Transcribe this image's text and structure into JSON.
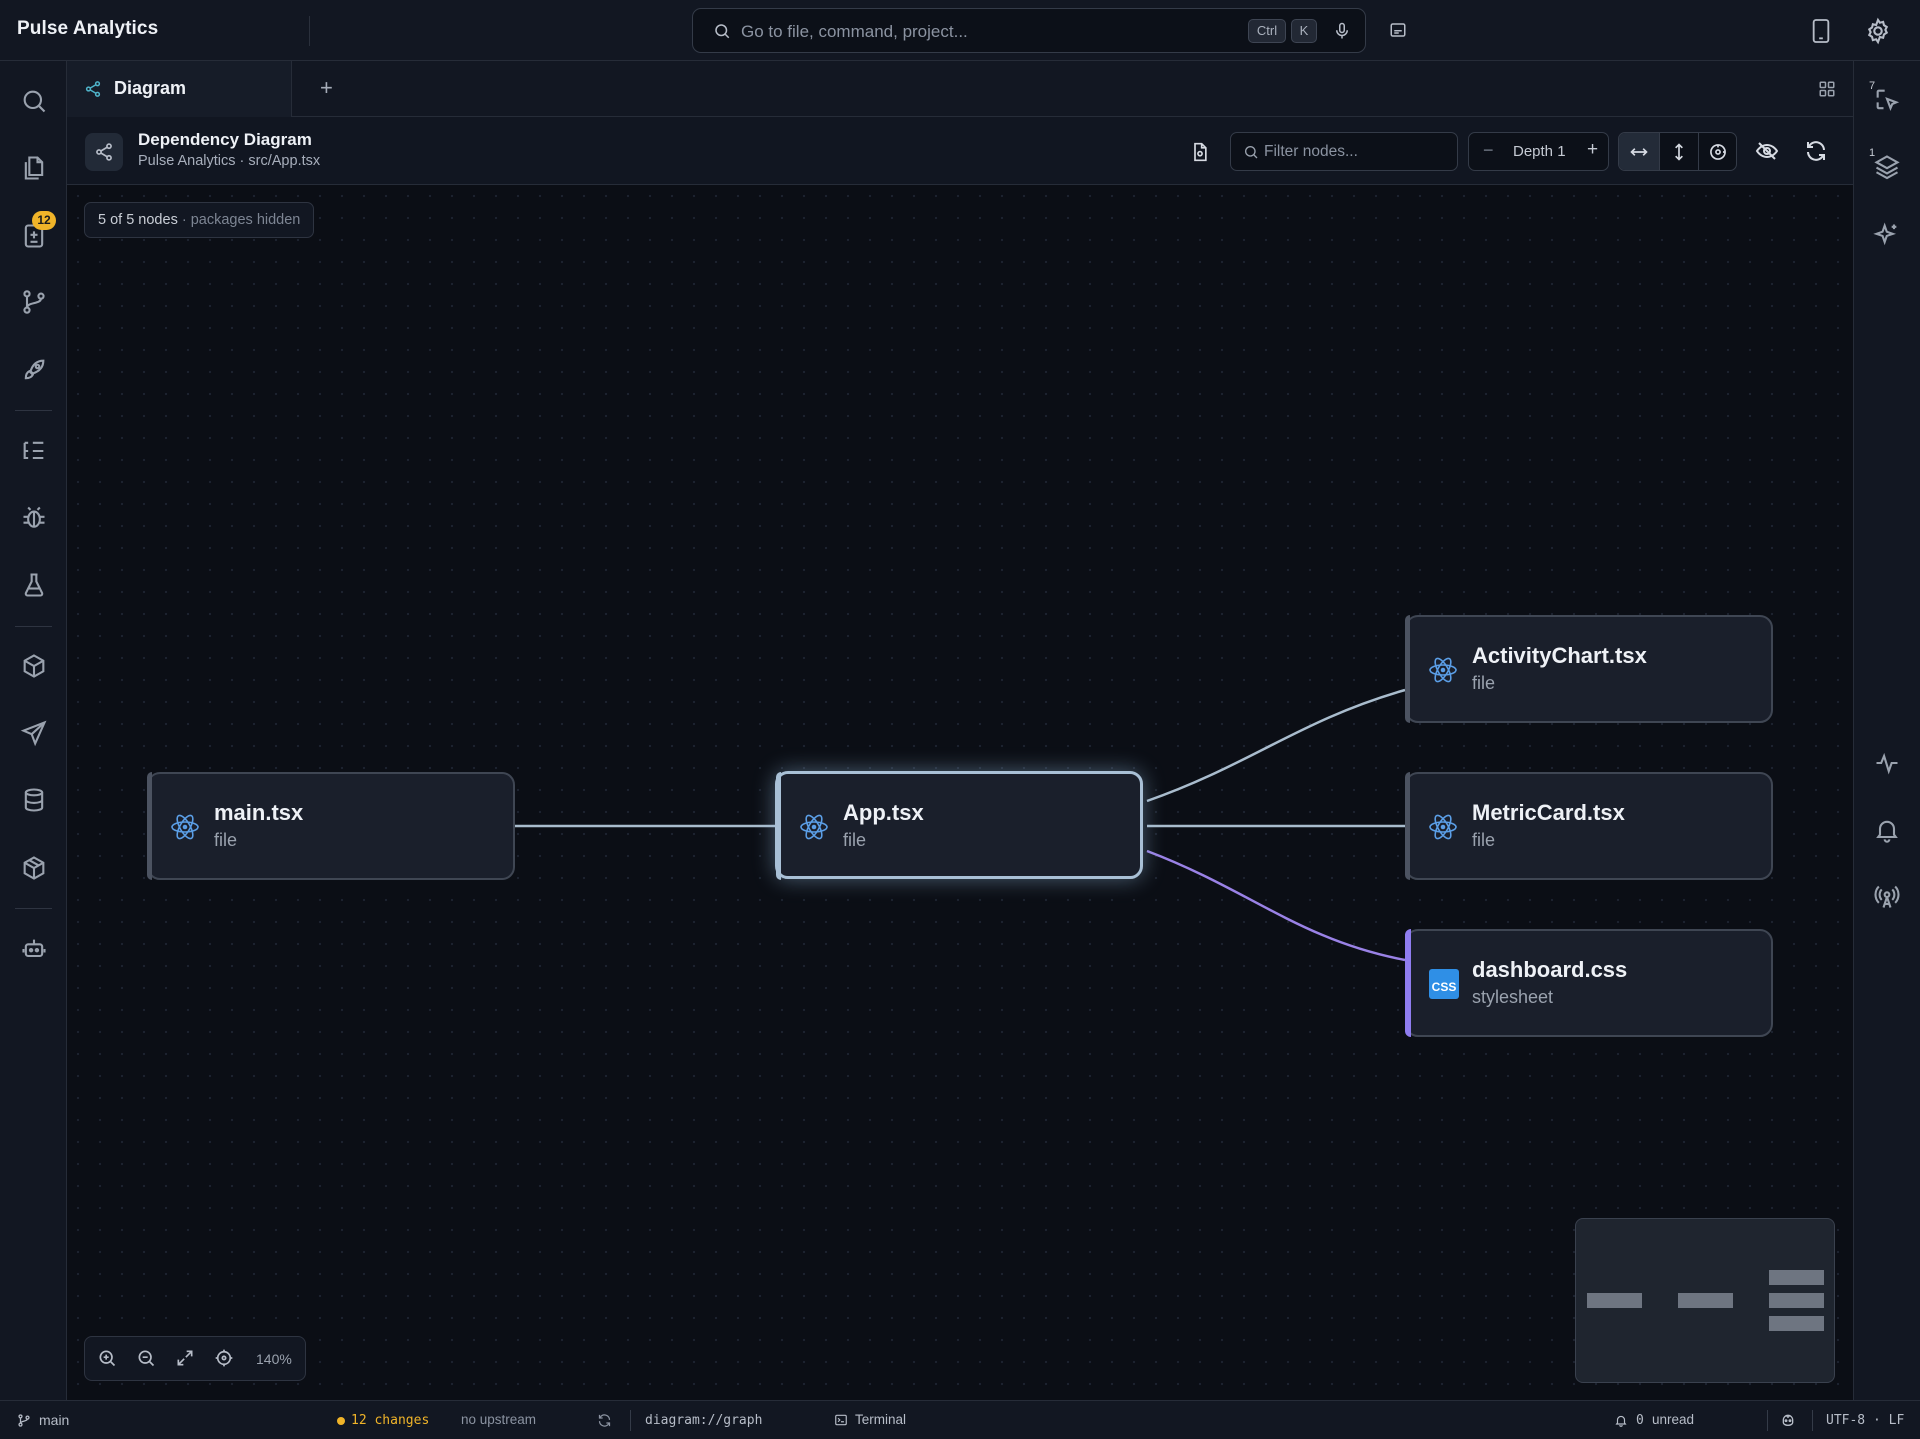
{
  "app": {
    "title": "Pulse Analytics"
  },
  "command_bar": {
    "placeholder": "Go to file, command, project...",
    "shortcut_ctrl": "Ctrl",
    "shortcut_key": "K"
  },
  "tabs": [
    {
      "label": "Diagram",
      "icon": "share-nodes-icon"
    }
  ],
  "diagram_header": {
    "title": "Dependency Diagram",
    "subtitle": "Pulse Analytics · src/App.tsx",
    "filter_placeholder": "Filter nodes...",
    "depth_label": "Depth 1"
  },
  "canvas": {
    "node_count": "5 of 5 nodes",
    "node_count_extra": "· packages hidden",
    "zoom": "140%"
  },
  "nodes": [
    {
      "name": "main.tsx",
      "type": "file",
      "icon": "react-icon"
    },
    {
      "name": "App.tsx",
      "type": "file",
      "icon": "react-icon",
      "selected": true
    },
    {
      "name": "ActivityChart.tsx",
      "type": "file",
      "icon": "react-icon"
    },
    {
      "name": "MetricCard.tsx",
      "type": "file",
      "icon": "react-icon"
    },
    {
      "name": "dashboard.css",
      "type": "stylesheet",
      "icon": "css-icon",
      "icon_text": "CSS"
    }
  ],
  "edges": [
    {
      "from": "main.tsx",
      "to": "App.tsx",
      "color": "#a9bccd"
    },
    {
      "from": "App.tsx",
      "to": "ActivityChart.tsx",
      "color": "#a9bccd"
    },
    {
      "from": "App.tsx",
      "to": "MetricCard.tsx",
      "color": "#a9bccd"
    },
    {
      "from": "App.tsx",
      "to": "dashboard.css",
      "color": "#9a82e6"
    }
  ],
  "left_activity_bar": {
    "items": [
      "search-icon",
      "files-icon",
      "changes-icon",
      "branch-icon",
      "rocket-icon",
      "outline-icon",
      "bug-icon",
      "flask-icon",
      "package-icon",
      "send-icon",
      "database-icon",
      "cube-icon",
      "robot-icon"
    ],
    "changes_badge": "12"
  },
  "right_activity_bar": {
    "items": [
      "inspect-icon",
      "layers-icon",
      "sparkle-icon",
      "activity-icon",
      "bell-icon",
      "broadcast-icon"
    ],
    "inspect_count": "7",
    "layers_count": "1"
  },
  "status_bar": {
    "branch": "main",
    "changes": "12 changes",
    "upstream": "no upstream",
    "uri": "diagram://graph",
    "terminal": "Terminal",
    "notifications": "0",
    "notifications_label": "unread",
    "encoding": "UTF-8 · LF"
  },
  "colors": {
    "accent": "#f0b429",
    "edge": "#a9bccd",
    "stylesheet_edge": "#9a82e6",
    "react": "#5b9ee6",
    "background": "#0b0e15"
  }
}
